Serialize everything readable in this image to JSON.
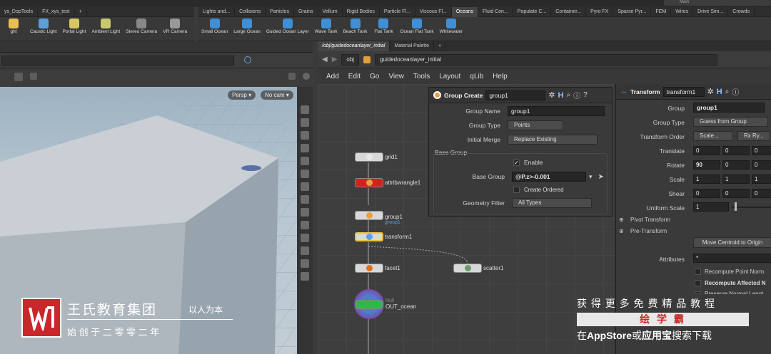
{
  "shelf": {
    "tabs_left": [
      "ys_DopTools",
      "FX_xys_test"
    ],
    "tabs_right": [
      "Lights and...",
      "Collisions",
      "Particles",
      "Grains",
      "Vellum",
      "Rigid Bodies",
      "Particle Fl...",
      "Viscous Fl...",
      "Oceans",
      "Fluid Con...",
      "Populate C...",
      "Container...",
      "Pyro FX",
      "Sparse Pyr...",
      "FEM",
      "Wires",
      "Drive Sim...",
      "Crowds"
    ],
    "active_tab": "Oceans",
    "main_label": "Main",
    "tools_left": [
      {
        "label": "ght",
        "icon": "light-icon"
      },
      {
        "label": "Caustic Light",
        "icon": "caustic-light-icon"
      },
      {
        "label": "Portal Light",
        "icon": "portal-light-icon"
      },
      {
        "label": "Ambient Light",
        "icon": "ambient-light-icon"
      },
      {
        "label": "Stereo Camera",
        "icon": "stereo-camera-icon"
      },
      {
        "label": "VR Camera",
        "icon": "vr-camera-icon"
      }
    ],
    "tools_right": [
      {
        "label": "Small Ocean",
        "icon": "small-ocean-icon"
      },
      {
        "label": "Large Ocean",
        "icon": "large-ocean-icon"
      },
      {
        "label": "Guided Ocean Layer",
        "icon": "guided-ocean-icon"
      },
      {
        "label": "Wave Tank",
        "icon": "wave-tank-icon"
      },
      {
        "label": "Beach Tank",
        "icon": "beach-tank-icon"
      },
      {
        "label": "Flat Tank",
        "icon": "flat-tank-icon"
      },
      {
        "label": "Ocean Flat Tank",
        "icon": "ocean-flat-tank-icon"
      },
      {
        "label": "Whitewater",
        "icon": "whitewater-icon"
      }
    ]
  },
  "viewport": {
    "persp_label": "Persp ▾",
    "cam_label": "No cam ▾"
  },
  "network": {
    "tabs": [
      "/obj/guidedoceanlayer_initial",
      "Material Palette"
    ],
    "path_obj": "obj",
    "path_node": "guidedoceanlayer_initial",
    "menu": [
      "Add",
      "Edit",
      "Go",
      "View",
      "Tools",
      "Layout",
      "qLib",
      "Help"
    ],
    "nodes": [
      {
        "name": "grid1",
        "sub": ""
      },
      {
        "name": "attribwrangle1",
        "sub": ""
      },
      {
        "name": "group1",
        "sub": "group1"
      },
      {
        "name": "transform1",
        "sub": ""
      },
      {
        "name": "facet1",
        "sub": ""
      },
      {
        "name": "scatter1",
        "sub": ""
      },
      {
        "name": "OUT_ocean",
        "sub": "Null"
      }
    ]
  },
  "group_panel": {
    "type_label": "Group Create",
    "node_name": "group1",
    "rows": {
      "group_name_label": "Group Name",
      "group_name_value": "group1",
      "group_type_label": "Group Type",
      "group_type_value": "Points",
      "initial_merge_label": "Initial Merge",
      "initial_merge_value": "Replace Existing",
      "base_group_section": "Base Group",
      "enable_label": "Enable",
      "base_group_label": "Base Group",
      "base_group_value": "@P.z>-0.001",
      "create_ordered_label": "Create Ordered",
      "geometry_filter_label": "Geometry Filter",
      "geometry_filter_value": "All Types"
    }
  },
  "transform_panel": {
    "type_label": "Transform",
    "node_name": "transform1",
    "group_label": "Group",
    "group_value": "group1",
    "group_type_label": "Group Type",
    "group_type_value": "Guess from Group",
    "order_label": "Transform Order",
    "order_value": "Scale...",
    "order_value2": "Rx Ry...",
    "translate_label": "Translate",
    "translate": [
      "0",
      "0",
      "0"
    ],
    "rotate_label": "Rotate",
    "rotate": [
      "90",
      "0",
      "0"
    ],
    "scale_label": "Scale",
    "scale": [
      "1",
      "1",
      "1"
    ],
    "shear_label": "Shear",
    "shear": [
      "0",
      "0",
      "0"
    ],
    "uniform_label": "Uniform Scale",
    "uniform_value": "1",
    "pivot_label": "Pivot Transform",
    "pre_label": "Pre-Transform",
    "centroid_button": "Move Centroid to Origin",
    "attributes_label": "Attributes",
    "attributes_value": "*",
    "recompute_normals": "Recompute Point Norm",
    "recompute_affected": "Recompute Affected N",
    "preserve": "Preserve Normal Lengt"
  },
  "brand": {
    "name": "王氏教育集团",
    "motto": "以人为本",
    "since": "始 创 于 二 零 零 二 年"
  },
  "promo": {
    "line1": "获 得 更 多 免 费 精 品 教 程",
    "line2": "绘 学 霸",
    "line3_a": "在",
    "line3_b": "AppStore",
    "line3_c": "或",
    "line3_d": "应用宝",
    "line3_e": "搜索下载"
  },
  "colors": {
    "accent_orange": "#e8a040",
    "wrangle_red": "#d62020",
    "out_green": "#2db84a",
    "brand_red": "#c8282a",
    "group_sub_blue": "#5aa0e6"
  }
}
